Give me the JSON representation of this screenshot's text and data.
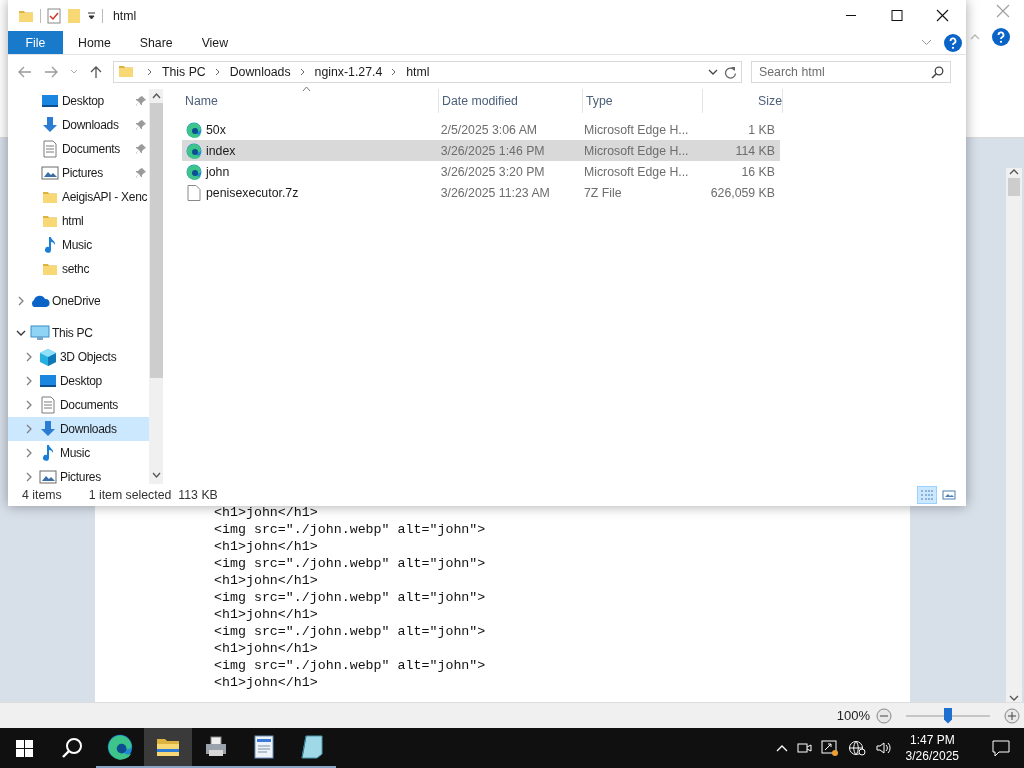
{
  "wordpad": {
    "document_lines": [
      "<h1>john</h1>",
      "<img src=\"./john.webp\" alt=\"john\">",
      "<h1>john</h1>",
      "<img src=\"./john.webp\" alt=\"john\">",
      "<h1>john</h1>",
      "<img src=\"./john.webp\" alt=\"john\">",
      "<h1>john</h1>",
      "<img src=\"./john.webp\" alt=\"john\">",
      "<h1>john</h1>",
      "<img src=\"./john.webp\" alt=\"john\">",
      "<h1>john</h1>"
    ],
    "zoom": {
      "reading": "100%",
      "level": 0.5
    }
  },
  "explorer": {
    "title": "html",
    "ribbon_tabs": [
      {
        "label": "File",
        "kind": "file",
        "selected": false
      },
      {
        "label": "Home",
        "kind": "tab",
        "selected": false
      },
      {
        "label": "Share",
        "kind": "tab",
        "selected": false
      },
      {
        "label": "View",
        "kind": "tab",
        "selected": false
      }
    ],
    "address": {
      "crumbs": [
        "This PC",
        "Downloads",
        "nginx-1.27.4",
        "html"
      ]
    },
    "search": {
      "placeholder": "Search html"
    },
    "quick_access": [
      {
        "label": "Desktop",
        "kind": "desktop",
        "pinned": true,
        "selected": false
      },
      {
        "label": "Downloads",
        "kind": "downloads",
        "pinned": true,
        "selected": false
      },
      {
        "label": "Documents",
        "kind": "documents",
        "pinned": true,
        "selected": false
      },
      {
        "label": "Pictures",
        "kind": "pictures",
        "pinned": true,
        "selected": false
      },
      {
        "label": "AeigisAPI - Xenc",
        "kind": "folder",
        "pinned": false,
        "selected": false
      },
      {
        "label": "html",
        "kind": "folder",
        "pinned": false,
        "selected": false
      },
      {
        "label": "Music",
        "kind": "music",
        "pinned": false,
        "selected": false
      },
      {
        "label": "sethc",
        "kind": "folder",
        "pinned": false,
        "selected": false
      }
    ],
    "tree": [
      {
        "label": "OneDrive",
        "kind": "cloud",
        "expanded": false,
        "selected": false
      },
      {
        "label": "This PC",
        "kind": "pc",
        "expanded": true,
        "selected": false,
        "children": [
          {
            "label": "3D Objects",
            "kind": "objects3d",
            "expanded": false,
            "selected": false
          },
          {
            "label": "Desktop",
            "kind": "desktop",
            "expanded": false,
            "selected": false
          },
          {
            "label": "Documents",
            "kind": "documents",
            "expanded": false,
            "selected": false
          },
          {
            "label": "Downloads",
            "kind": "downloads",
            "expanded": false,
            "selected": true
          },
          {
            "label": "Music",
            "kind": "music",
            "expanded": false,
            "selected": false
          },
          {
            "label": "Pictures",
            "kind": "pictures",
            "expanded": false,
            "selected": false
          }
        ]
      }
    ],
    "columns": [
      {
        "label": "Name",
        "sorted": true
      },
      {
        "label": "Date modified",
        "sorted": false
      },
      {
        "label": "Type",
        "sorted": false
      },
      {
        "label": "Size",
        "sorted": false
      }
    ],
    "files": [
      {
        "name": "50x",
        "kind": "edge",
        "date": "2/5/2025 3:06 AM",
        "type": "Microsoft Edge H...",
        "size": "1 KB",
        "selected": false
      },
      {
        "name": "index",
        "kind": "edge",
        "date": "3/26/2025 1:46 PM",
        "type": "Microsoft Edge H...",
        "size": "114 KB",
        "selected": true
      },
      {
        "name": "john",
        "kind": "edge",
        "date": "3/26/2025 3:20 PM",
        "type": "Microsoft Edge H...",
        "size": "16 KB",
        "selected": false
      },
      {
        "name": "penisexecutor.7z",
        "kind": "file",
        "date": "3/26/2025 11:23 AM",
        "type": "7Z File",
        "size": "626,059 KB",
        "selected": false
      }
    ],
    "status_bar": {
      "item_count": "4 items",
      "selection": "1 item selected",
      "selection_size": "113 KB"
    },
    "view_buttons": [
      {
        "kind": "details",
        "selected": true
      },
      {
        "kind": "large-icons",
        "selected": false
      }
    ]
  },
  "taskbar": {
    "apps": [
      {
        "kind": "edge",
        "selected": false
      },
      {
        "kind": "explorer",
        "selected": true
      },
      {
        "kind": "tool",
        "selected": false
      },
      {
        "kind": "document",
        "selected": false
      },
      {
        "kind": "notepad",
        "selected": false
      }
    ],
    "time": "1:47 PM",
    "date": "3/26/2025"
  }
}
